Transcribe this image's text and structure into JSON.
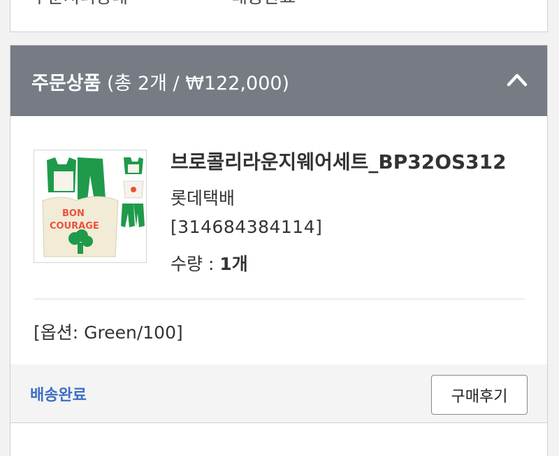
{
  "top_section": {
    "label": "주문처리상태",
    "value": "배송완료"
  },
  "order_items": {
    "title": "주문상품",
    "summary": "(총 2개 / ₩122,000)",
    "toggle_icon": "chevron-up-icon"
  },
  "product": {
    "name": "브로콜리라운지웨어세트_BP32OS312",
    "courier": "롯데택배",
    "tracking": "[314684384114]",
    "qty_label": "수량 : ",
    "qty_value": "1개",
    "option": "[옵션: Green/100]",
    "thumb_text": [
      "BON",
      "COURAGE"
    ]
  },
  "actions": {
    "status": "배송완료",
    "review_button": "구매후기"
  },
  "colors": {
    "header_bg": "#767b84",
    "status_blue": "#3d6fc4",
    "product_green": "#1f9a4b",
    "product_red": "#e8543a"
  }
}
